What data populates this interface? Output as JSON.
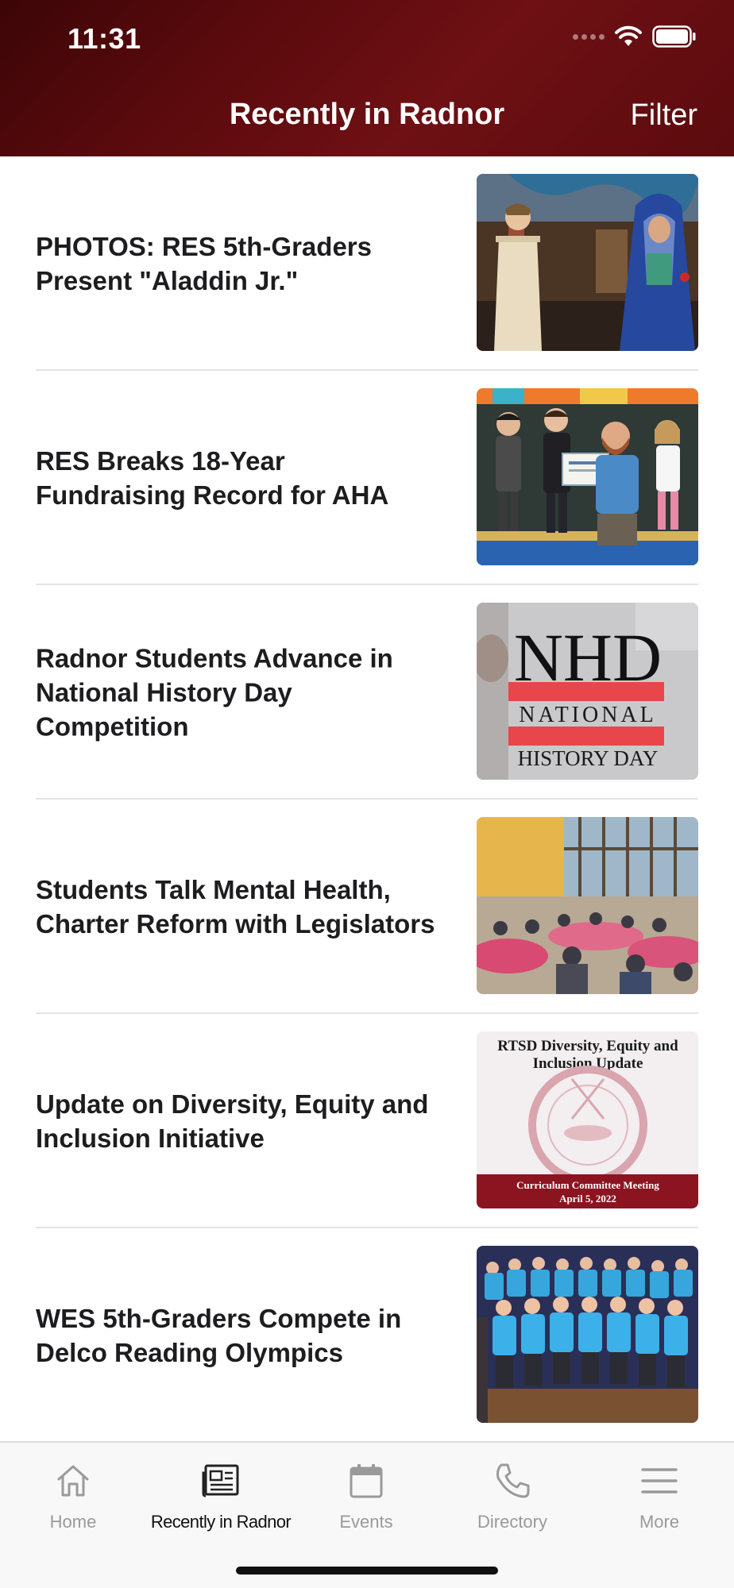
{
  "status_bar": {
    "time": "11:31"
  },
  "header": {
    "title": "Recently in Radnor",
    "filter_label": "Filter"
  },
  "articles": [
    {
      "headline": "PHOTOS: RES 5th-Graders Present \"Aladdin Jr.\""
    },
    {
      "headline": "RES Breaks 18-Year Fundraising Record for AHA"
    },
    {
      "headline": "Radnor Students Advance in National History Day Competition",
      "thumb_text": {
        "big": "NHD",
        "line1": "NATIONAL",
        "line2": "HISTORY DAY"
      }
    },
    {
      "headline": "Students Talk Mental Health, Charter Reform with Legislators"
    },
    {
      "headline": "Update on Diversity, Equity and Inclusion Initiative",
      "thumb_text": {
        "title1": "RTSD Diversity, Equity and",
        "title2": "Inclusion Update",
        "foot1": "Curriculum Committee Meeting",
        "foot2": "April 5, 2022"
      }
    },
    {
      "headline": "WES 5th-Graders Compete in Delco Reading Olympics"
    }
  ],
  "tabbar": {
    "tabs": [
      {
        "label": "Home",
        "icon": "home-icon",
        "active": false
      },
      {
        "label": "Recently in Radnor",
        "icon": "newspaper-icon",
        "active": true
      },
      {
        "label": "Events",
        "icon": "calendar-icon",
        "active": false
      },
      {
        "label": "Directory",
        "icon": "phone-icon",
        "active": false
      },
      {
        "label": "More",
        "icon": "menu-icon",
        "active": false
      }
    ]
  },
  "colors": {
    "header_bg": "#5a0a0d",
    "nhd_red": "#e8464a",
    "dei_maroon": "#8b1420",
    "shirt_blue": "#37a6dd"
  }
}
